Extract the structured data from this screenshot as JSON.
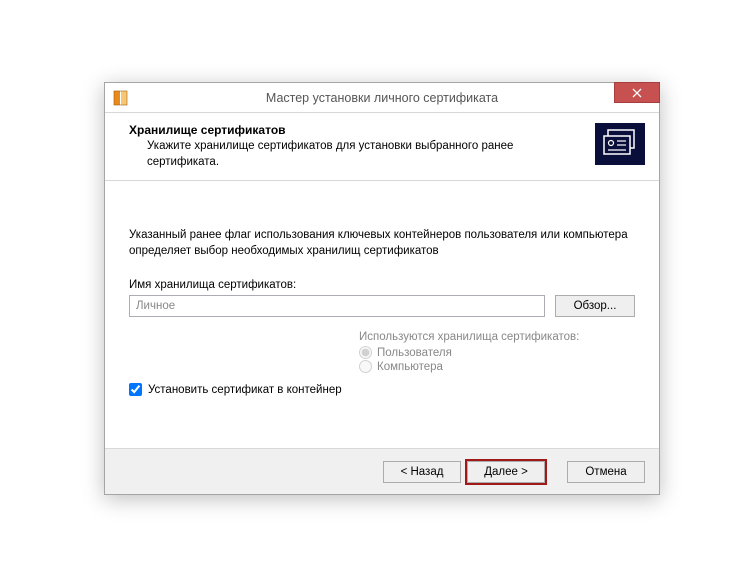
{
  "window": {
    "title": "Мастер установки личного сертификата"
  },
  "header": {
    "title": "Хранилище сертификатов",
    "description": "Укажите хранилище сертификатов для установки выбранного ранее сертификата."
  },
  "content": {
    "info": "Указанный ранее флаг использования ключевых контейнеров пользователя или компьютера определяет выбор необходимых хранилищ сертификатов",
    "store_label": "Имя хранилища сертификатов:",
    "store_value": "Личное",
    "browse": "Обзор...",
    "radio_title": "Используются хранилища сертификатов:",
    "radio_user": "Пользователя",
    "radio_computer": "Компьютера",
    "checkbox_label": "Установить сертификат в контейнер"
  },
  "footer": {
    "back": "< Назад",
    "next": "Далее >",
    "cancel": "Отмена"
  }
}
